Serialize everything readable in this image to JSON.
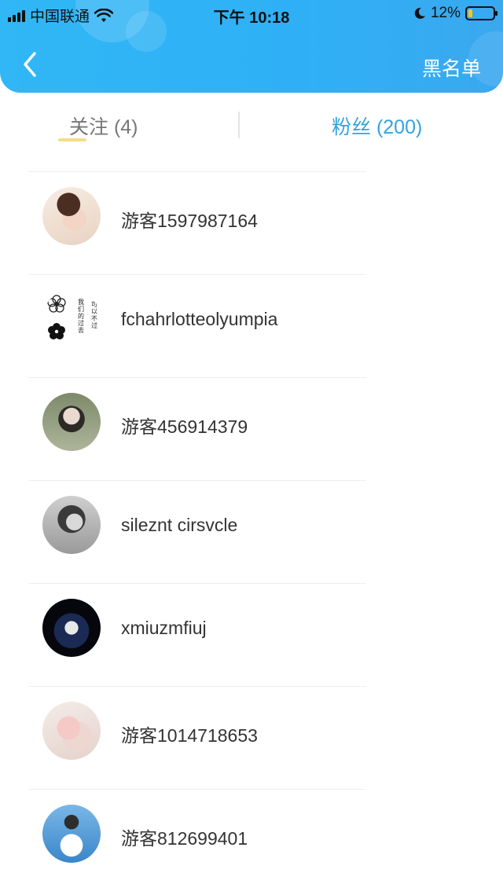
{
  "status_bar": {
    "carrier": "中国联通",
    "time": "下午 10:18",
    "battery": "12%",
    "battery_level_percent": 12,
    "icons": [
      "signal-icon",
      "wifi-icon",
      "moon-icon",
      "battery-icon"
    ]
  },
  "header": {
    "back_icon": "chevron-left-icon",
    "blacklist_label": "黑名单",
    "accent_color": "#31b7f5"
  },
  "tabs": {
    "follow_label": "关注 (4)",
    "fans_label": "粉丝 (200)",
    "active_color": "#34a3dd"
  },
  "users": [
    {
      "name": "游客1597987164"
    },
    {
      "name": "fchahrlotteolyumpia",
      "avatar_text": "不可以不过 我们的过去"
    },
    {
      "name": "游客456914379"
    },
    {
      "name": "sileznt cirsvcle"
    },
    {
      "name": "xmiuzmfiuj"
    },
    {
      "name": "游客1014718653"
    },
    {
      "name": "游客812699401"
    }
  ]
}
